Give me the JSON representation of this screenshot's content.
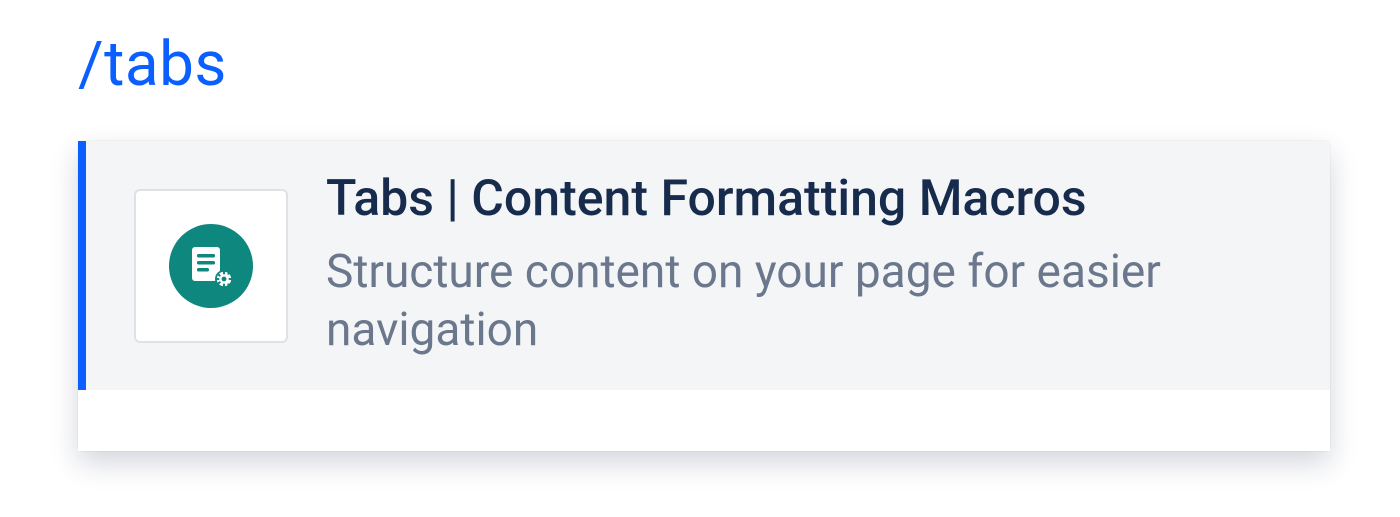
{
  "search": {
    "query": "/tabs"
  },
  "results": [
    {
      "title": "Tabs | Content Formatting Macros",
      "description": "Structure content on your page for easier navigation",
      "icon": "macro-page-gear-icon"
    }
  ],
  "colors": {
    "accent": "#0b5fff",
    "item_bg": "#f4f5f7",
    "text_primary": "#172b4d",
    "text_secondary": "#6b778c",
    "icon_badge": "#0e877e"
  }
}
